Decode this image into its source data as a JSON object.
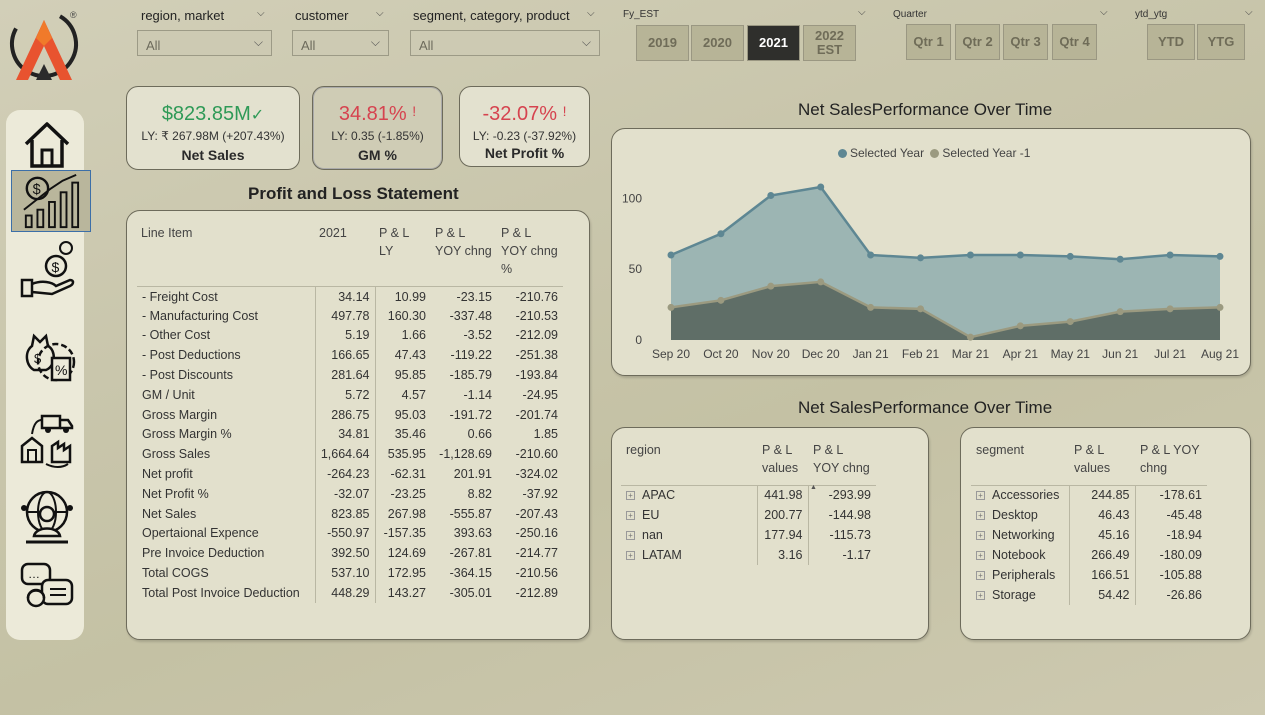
{
  "filters": {
    "region_market": {
      "label": "region, market",
      "value": "All"
    },
    "customer": {
      "label": "customer",
      "value": "All"
    },
    "segment": {
      "label": "segment, category, product",
      "value": "All"
    }
  },
  "fy_est": {
    "label": "Fy_EST",
    "options": [
      "2019",
      "2020",
      "2021",
      "2022\nEST"
    ],
    "selected": "2021"
  },
  "quarter": {
    "label": "Quarter",
    "options": [
      "Qtr 1",
      "Qtr 2",
      "Qtr 3",
      "Qtr 4"
    ]
  },
  "ytd_ytg": {
    "label": "ytd_ytg",
    "options": [
      "YTD",
      "YTG"
    ]
  },
  "logo": {
    "mark": "®"
  },
  "nav": {
    "items": [
      "home-icon",
      "sales-growth-icon",
      "hand-money-icon",
      "finance-percent-icon",
      "supply-chain-icon",
      "global-support-icon",
      "chat-support-icon"
    ],
    "active": "sales-growth-icon"
  },
  "kpis": {
    "net_sales": {
      "value": "$823.85M",
      "ly": "LY: ₹ 267.98M (+207.43%)",
      "name": "Net Sales",
      "mark": "✓",
      "color": "#2f9a57"
    },
    "gm": {
      "value": "34.81%",
      "ly": "LY: 0.35 (-1.85%)",
      "name": "GM %",
      "mark": "!",
      "color": "#d6434f"
    },
    "net_profit": {
      "value": "-32.07%",
      "ly": "LY: -0.23 (-37.92%)",
      "name": "Net Profit %",
      "mark": "!",
      "color": "#d6434f"
    }
  },
  "pl": {
    "title": "Profit and Loss Statement",
    "headers": [
      "Line Item",
      "2021",
      "P & L\nLY",
      "P & L\nYOY chng",
      "P & L\nYOY chng\n%"
    ],
    "rows": [
      [
        "- Freight Cost",
        "34.14",
        "10.99",
        "-23.15",
        "-210.76"
      ],
      [
        "- Manufacturing Cost",
        "497.78",
        "160.30",
        "-337.48",
        "-210.53"
      ],
      [
        "- Other Cost",
        "5.19",
        "1.66",
        "-3.52",
        "-212.09"
      ],
      [
        "- Post Deductions",
        "166.65",
        "47.43",
        "-119.22",
        "-251.38"
      ],
      [
        "- Post Discounts",
        "281.64",
        "95.85",
        "-185.79",
        "-193.84"
      ],
      [
        "GM / Unit",
        "5.72",
        "4.57",
        "-1.14",
        "-24.95"
      ],
      [
        "Gross Margin",
        "286.75",
        "95.03",
        "-191.72",
        "-201.74"
      ],
      [
        "Gross Margin %",
        "34.81",
        "35.46",
        "0.66",
        "1.85"
      ],
      [
        "Gross Sales",
        "1,664.64",
        "535.95",
        "-1,128.69",
        "-210.60"
      ],
      [
        "Net profit",
        "-264.23",
        "-62.31",
        "201.91",
        "-324.02"
      ],
      [
        "Net Profit %",
        "-32.07",
        "-23.25",
        "8.82",
        "-37.92"
      ],
      [
        "Net Sales",
        "823.85",
        "267.98",
        "-555.87",
        "-207.43"
      ],
      [
        "Opertaional Expence",
        "-550.97",
        "-157.35",
        "393.63",
        "-250.16"
      ],
      [
        "Pre Invoice Deduction",
        "392.50",
        "124.69",
        "-267.81",
        "-214.77"
      ],
      [
        "Total COGS",
        "537.10",
        "172.95",
        "-364.15",
        "-210.56"
      ],
      [
        "Total Post Invoice Deduction",
        "448.29",
        "143.27",
        "-305.01",
        "-212.89"
      ]
    ]
  },
  "chart_title": "Net SalesPerformance Over Time",
  "chart_data": {
    "type": "area",
    "x": [
      "Sep 20",
      "Oct 20",
      "Nov 20",
      "Dec 20",
      "Jan 21",
      "Feb 21",
      "Mar 21",
      "Apr 21",
      "May 21",
      "Jun 21",
      "Jul 21",
      "Aug 21"
    ],
    "series": [
      {
        "name": "Selected Year",
        "color": "#5e8793",
        "values": [
          60,
          75,
          102,
          108,
          60,
          58,
          60,
          60,
          59,
          57,
          60,
          59
        ]
      },
      {
        "name": "Selected Year -1",
        "color": "#9b9a80",
        "values": [
          23,
          28,
          38,
          41,
          23,
          22,
          2,
          10,
          13,
          20,
          22,
          23
        ]
      }
    ],
    "yticks": [
      "0",
      "50",
      "100"
    ],
    "ylim": [
      0,
      120
    ],
    "legend": "top-center"
  },
  "region_table": {
    "title": "Net SalesPerformance Over Time",
    "headers": [
      "region",
      "P & L\nvalues",
      "P & L\nYOY chng"
    ],
    "sort_indicator": "▲",
    "rows": [
      [
        "APAC",
        "441.98",
        "-293.99"
      ],
      [
        "EU",
        "200.77",
        "-144.98"
      ],
      [
        "nan",
        "177.94",
        "-115.73"
      ],
      [
        "LATAM",
        "3.16",
        "-1.17"
      ]
    ]
  },
  "segment_table": {
    "headers": [
      "segment",
      "P & L\nvalues",
      "P & L YOY\nchng"
    ],
    "rows": [
      [
        "Accessories",
        "244.85",
        "-178.61"
      ],
      [
        "Desktop",
        "46.43",
        "-45.48"
      ],
      [
        "Networking",
        "45.16",
        "-18.94"
      ],
      [
        "Notebook",
        "266.49",
        "-180.09"
      ],
      [
        "Peripherals",
        "166.51",
        "-105.88"
      ],
      [
        "Storage",
        "54.42",
        "-26.86"
      ]
    ]
  }
}
